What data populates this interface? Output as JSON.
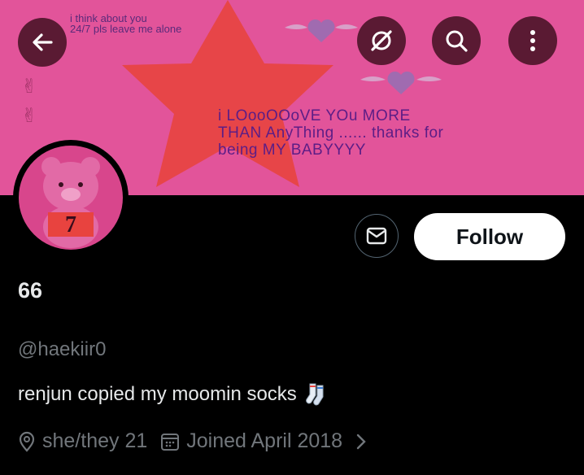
{
  "banner": {
    "small_text": "i think about you\n24/7 pls leave me alone",
    "big_text": "i LOooOOoVE YOu MORE\nTHAN AnyThing ...... thanks for\nbeing MY BABYYYY"
  },
  "header": {
    "back_icon": "arrow-left-icon",
    "grok_icon": "grok-slash-icon",
    "search_icon": "search-icon",
    "more_icon": "more-vertical-icon"
  },
  "avatar": {
    "badge_number": "7"
  },
  "actions": {
    "follow_label": "Follow",
    "message_icon": "envelope-icon"
  },
  "profile": {
    "display_name": "66",
    "handle": "@haekiir0",
    "bio": "renjun copied my moomin socks",
    "bio_emoji": "socks-emoji",
    "location": "she/they 21",
    "joined": "Joined April 2018"
  },
  "colors": {
    "banner": "#e2549a",
    "button_bg": "#5a1a33",
    "muted": "#71767b"
  }
}
